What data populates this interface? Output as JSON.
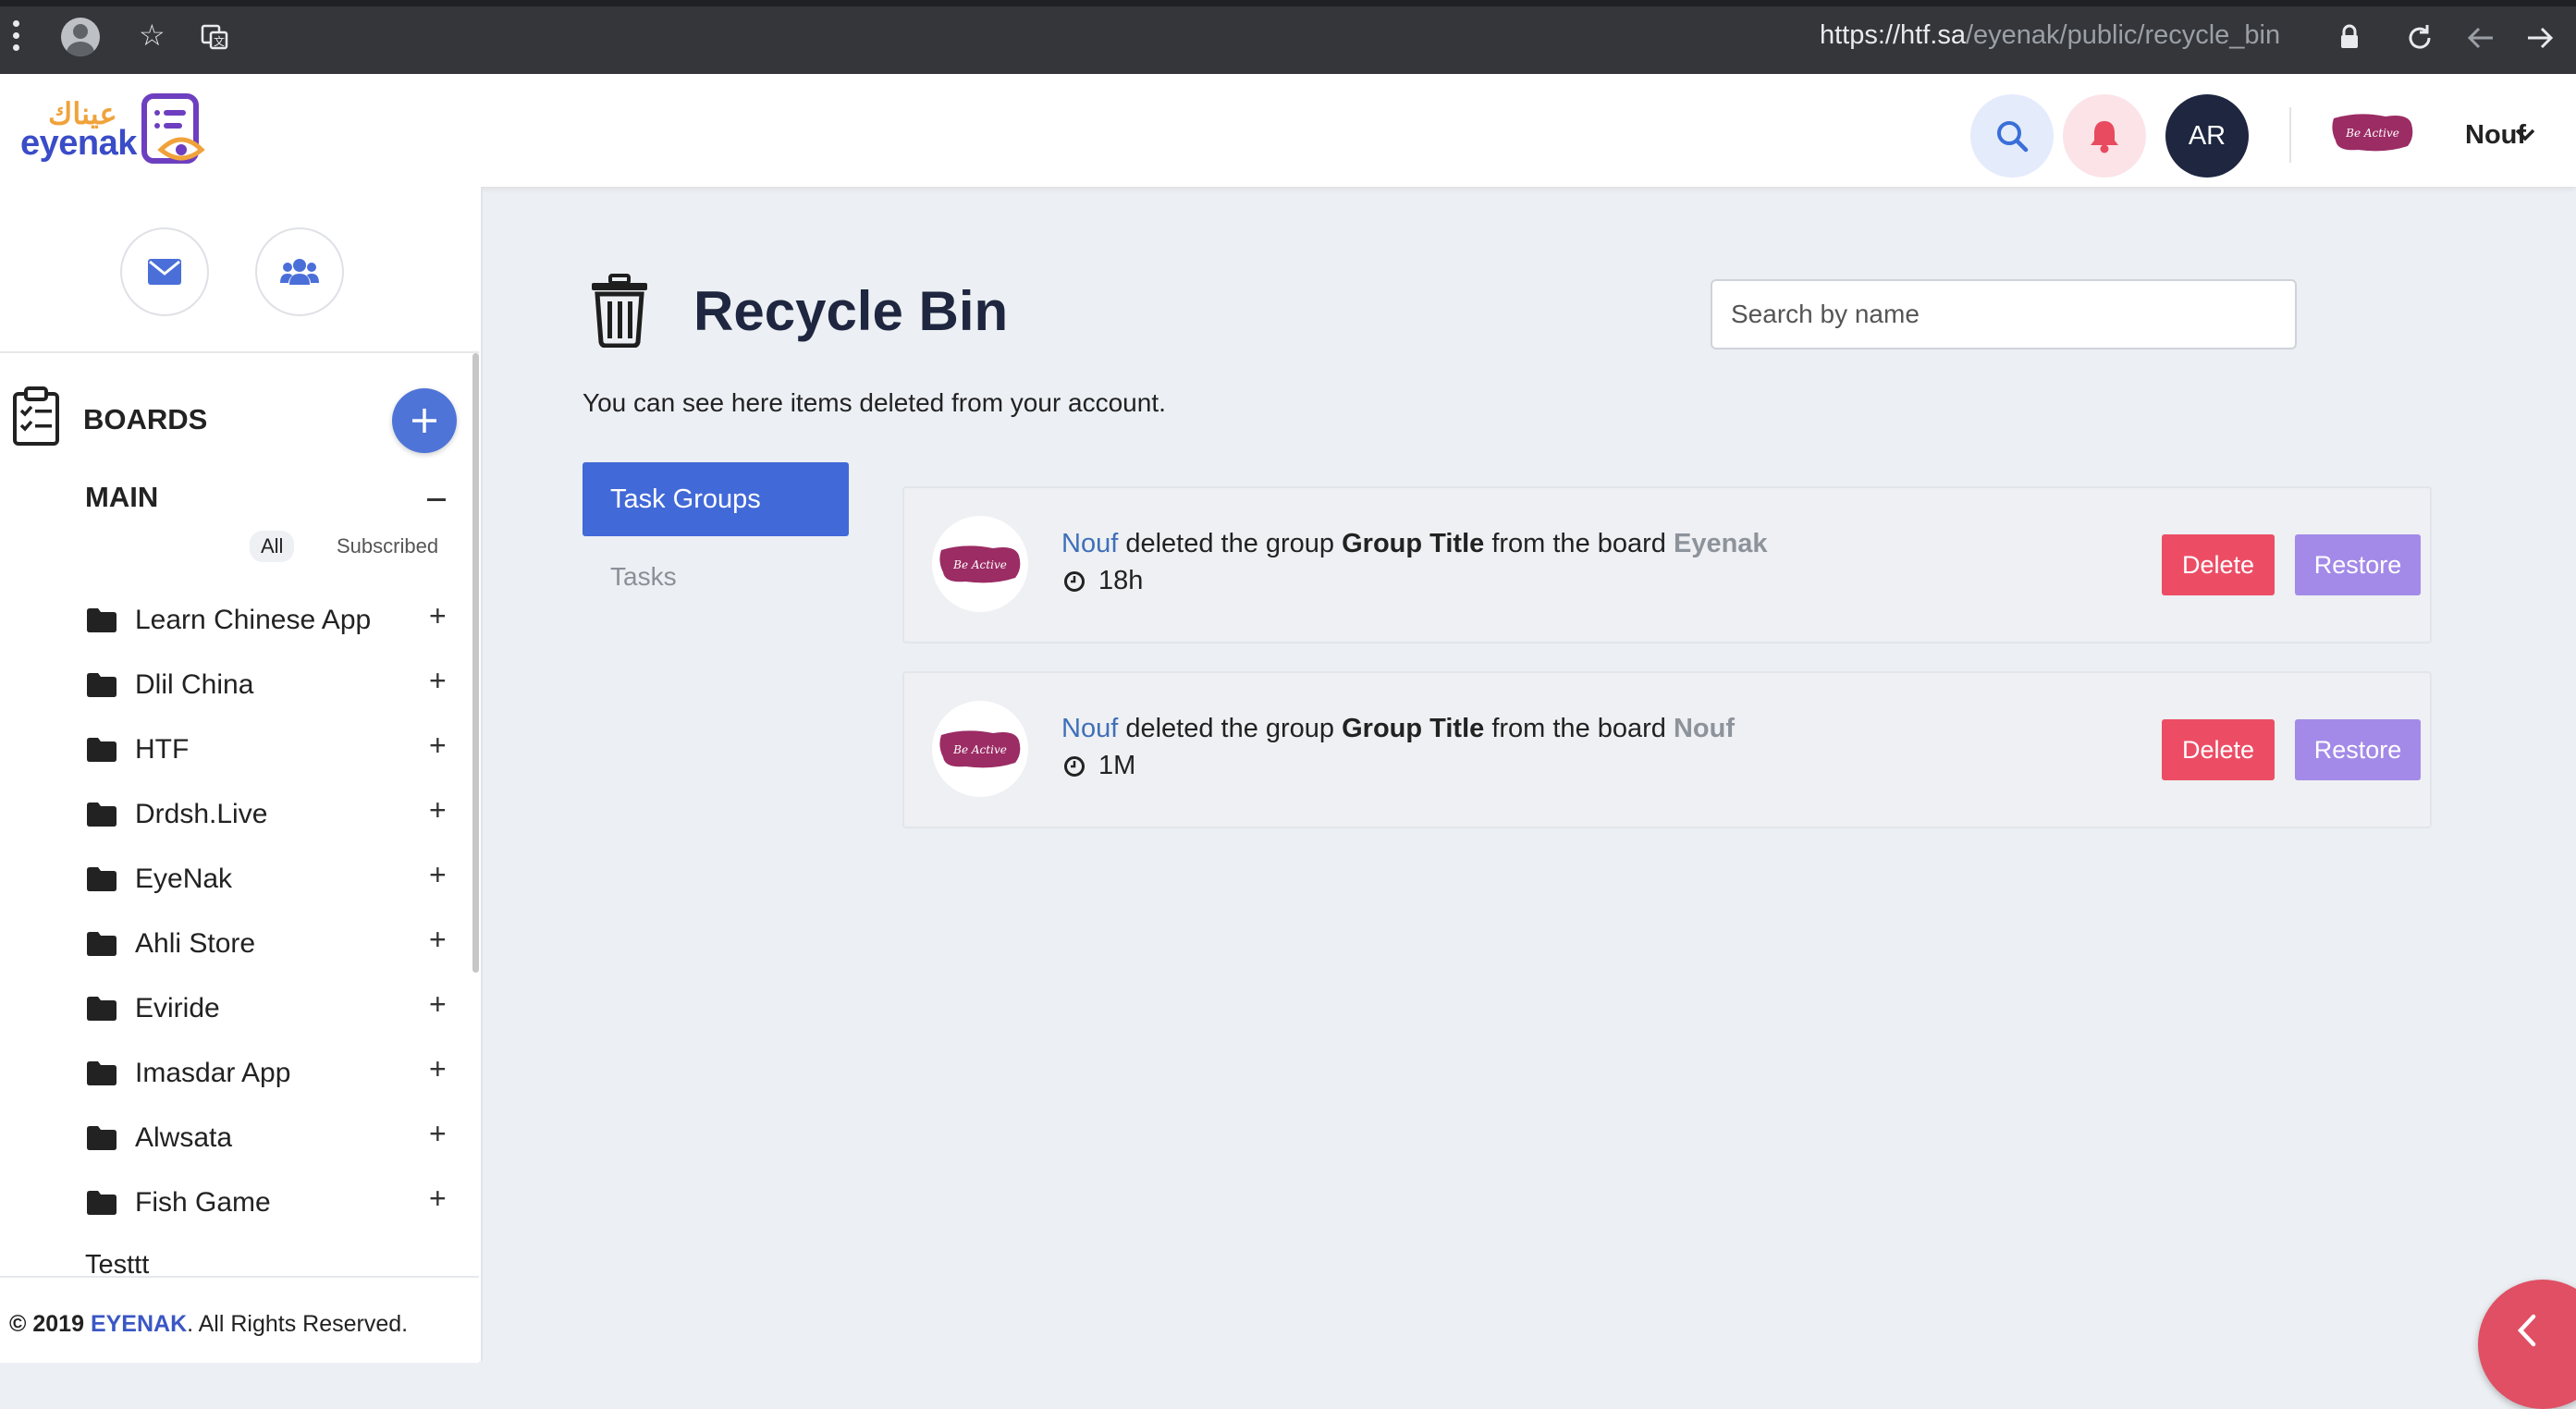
{
  "browser": {
    "url_host": "https://htf.sa",
    "url_path": "/eyenak/public/recycle_bin"
  },
  "header": {
    "logo_ar": "عيناك",
    "logo_en": "eyenak",
    "language_button": "AR",
    "user_name": "Nouf",
    "user_avatar_text": "Be Active"
  },
  "sidebar": {
    "boards_title": "BOARDS",
    "group_title": "MAIN",
    "filter_all": "All",
    "filter_subscribed": "Subscribed",
    "boards": [
      {
        "name": "Learn Chinese App"
      },
      {
        "name": "Dlil China"
      },
      {
        "name": "HTF"
      },
      {
        "name": "Drdsh.Live"
      },
      {
        "name": "EyeNak"
      },
      {
        "name": "Ahli Store"
      },
      {
        "name": "Eviride"
      },
      {
        "name": "Imasdar App"
      },
      {
        "name": "Alwsata"
      },
      {
        "name": "Fish Game"
      }
    ],
    "extra_item": "Testtt",
    "footer": {
      "copyright": "© 2019",
      "brand": "EYENAK",
      "rights": ". All Rights Reserved."
    }
  },
  "main": {
    "title": "Recycle Bin",
    "subtitle": "You can see here items deleted from your account.",
    "search_placeholder": "Search by name",
    "tabs": {
      "active": "Task Groups",
      "inactive": "Tasks"
    },
    "items": [
      {
        "actor": "Nouf",
        "text_a": " deleted the group ",
        "group_name": "Group Title",
        "text_b": " from the board ",
        "board_name": "Eyenak",
        "time": "18h",
        "avatar_text": "Be Active",
        "delete_label": "Delete",
        "restore_label": "Restore"
      },
      {
        "actor": "Nouf",
        "text_a": " deleted the group ",
        "group_name": "Group Title",
        "text_b": " from the board ",
        "board_name": "Nouf",
        "time": "1M",
        "avatar_text": "Be Active",
        "delete_label": "Delete",
        "restore_label": "Restore"
      }
    ]
  },
  "colors": {
    "primary": "#4169d8",
    "danger": "#ec4d65",
    "restore": "#a38ae8",
    "header_dark": "#1e2640",
    "brand_magenta": "#9b2c64"
  }
}
